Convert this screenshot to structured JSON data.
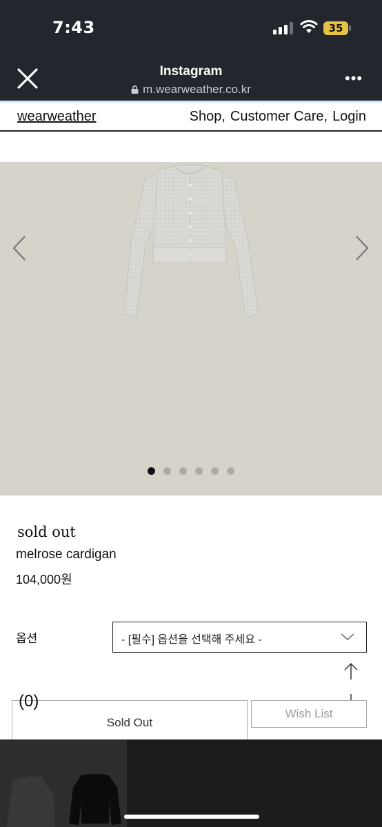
{
  "status_bar": {
    "time": "7:43",
    "battery": "35",
    "colors": {
      "background": "#23272d",
      "battery": "#e7c341"
    },
    "icons": [
      "signal-icon",
      "wifi-icon",
      "battery-icon"
    ]
  },
  "browser": {
    "title": "Instagram",
    "url": "m.wearweather.co.kr",
    "close_icon": "close-icon",
    "more_label": "•••"
  },
  "site_header": {
    "logo": "wearweather",
    "nav": [
      "Shop,",
      "Customer Care,",
      "Login"
    ]
  },
  "gallery": {
    "background": "#d6d3ca",
    "slide_count": 6,
    "active_index": 0,
    "icons": [
      "chevron-left-icon",
      "chevron-right-icon"
    ]
  },
  "product": {
    "status": "sold out",
    "name": "melrose cardigan",
    "price": "104,000원"
  },
  "options": {
    "label": "옵션",
    "select_value": "- [필수] 옵션을 선택해 주세요 -"
  },
  "cart": {
    "count": "(0)"
  },
  "buttons": {
    "sold_out": "Sold Out",
    "wish_list": "Wish List"
  }
}
